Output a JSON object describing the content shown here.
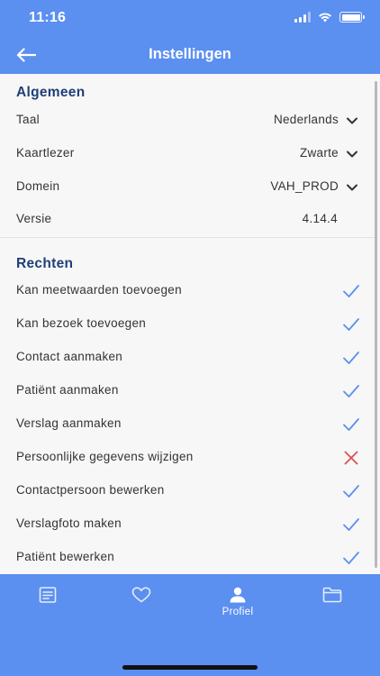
{
  "status_bar": {
    "time": "11:16"
  },
  "header": {
    "title": "Instellingen",
    "back_icon": "arrow-left-icon"
  },
  "general": {
    "title": "Algemeen",
    "rows": [
      {
        "label": "Taal",
        "value": "Nederlands",
        "dropdown": true
      },
      {
        "label": "Kaartlezer",
        "value": "Zwarte",
        "dropdown": true
      },
      {
        "label": "Domein",
        "value": "VAH_PROD",
        "dropdown": true
      },
      {
        "label": "Versie",
        "value": "4.14.4",
        "dropdown": false
      }
    ]
  },
  "rights": {
    "title": "Rechten",
    "rows": [
      {
        "label": "Kan meetwaarden toevoegen",
        "allowed": true
      },
      {
        "label": "Kan bezoek toevoegen",
        "allowed": true
      },
      {
        "label": "Contact aanmaken",
        "allowed": true
      },
      {
        "label": "Patiënt aanmaken",
        "allowed": true
      },
      {
        "label": "Verslag aanmaken",
        "allowed": true
      },
      {
        "label": "Persoonlijke gegevens wijzigen",
        "allowed": false
      },
      {
        "label": "Contactpersoon bewerken",
        "allowed": true
      },
      {
        "label": "Verslagfoto maken",
        "allowed": true
      },
      {
        "label": "Patiënt bewerken",
        "allowed": true
      }
    ]
  },
  "tabbar": {
    "tabs": [
      {
        "icon": "document-list-icon",
        "label": ""
      },
      {
        "icon": "heart-icon",
        "label": ""
      },
      {
        "icon": "person-icon",
        "label": "Profiel",
        "active": true
      },
      {
        "icon": "folder-icon",
        "label": ""
      }
    ]
  },
  "colors": {
    "accent": "#5b8ff0",
    "section_title": "#1f3f78",
    "check": "#5b8ff0",
    "cross": "#d9534f"
  }
}
